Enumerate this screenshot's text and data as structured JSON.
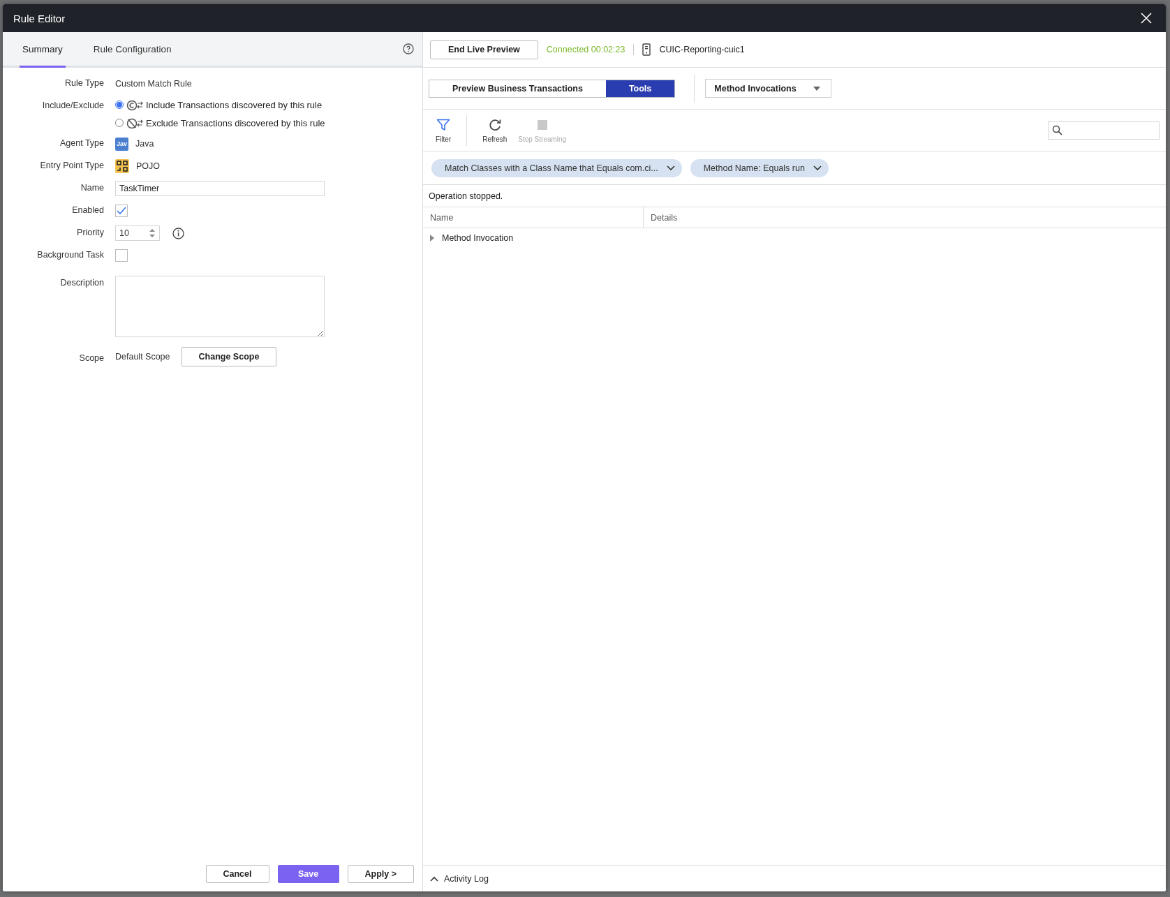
{
  "window": {
    "title": "Rule Editor"
  },
  "tabs": [
    {
      "label": "Summary",
      "selected": true
    },
    {
      "label": "Rule Configuration",
      "selected": false
    }
  ],
  "form": {
    "rows": [
      {
        "kind": "text",
        "label": "Rule Type",
        "value": "Custom Match Rule"
      },
      {
        "kind": "radios",
        "label": "Include/Exclude",
        "options": [
          {
            "label": "Include Transactions discovered by this rule",
            "selected": true,
            "kind": "include"
          },
          {
            "label": "Exclude Transactions discovered by this rule",
            "selected": false,
            "kind": "exclude"
          }
        ]
      },
      {
        "kind": "agent",
        "label": "Agent Type",
        "badge": "Jav",
        "value": "Java"
      },
      {
        "kind": "entry",
        "label": "Entry Point Type",
        "value": "POJO"
      },
      {
        "kind": "input",
        "label": "Name",
        "value": "TaskTimer"
      },
      {
        "kind": "checkbox",
        "label": "Enabled",
        "checked": true
      },
      {
        "kind": "number",
        "label": "Priority",
        "value": "10"
      },
      {
        "kind": "checkbox",
        "label": "Background Task",
        "checked": false
      },
      {
        "kind": "textarea",
        "label": "Description"
      },
      {
        "kind": "scope",
        "label": "Scope",
        "value": "Default Scope",
        "button": "Change Scope"
      }
    ]
  },
  "footer_buttons": [
    {
      "label": "Cancel",
      "kind": "secondary"
    },
    {
      "label": "Save",
      "kind": "primary"
    },
    {
      "label": "Apply >",
      "kind": "secondary"
    }
  ],
  "preview": {
    "end_button": "End Live Preview",
    "status": "Connected 00:02:23",
    "node": "CUIC-Reporting-cuic1",
    "modes": [
      {
        "label": "Preview Business Transactions",
        "selected": false
      },
      {
        "label": "Tools",
        "selected": true
      }
    ],
    "dropdown": "Method Invocations",
    "toolbar": [
      {
        "label": "Filter",
        "kind": "filter",
        "disabled": false
      },
      {
        "label": "Refresh",
        "kind": "refresh",
        "disabled": false
      },
      {
        "label": "Stop Streaming",
        "kind": "stop",
        "disabled": true
      }
    ],
    "filters": [
      "Match Classes with a Class Name that Equals com.ci...",
      "Method Name: Equals run"
    ],
    "message": "Operation stopped.",
    "table": {
      "columns": [
        "Name",
        "Details"
      ],
      "rows": [
        {
          "name": "Method Invocation",
          "expanded": false
        }
      ]
    },
    "activity_log": {
      "label": "Activity Log",
      "expanded": false
    }
  }
}
